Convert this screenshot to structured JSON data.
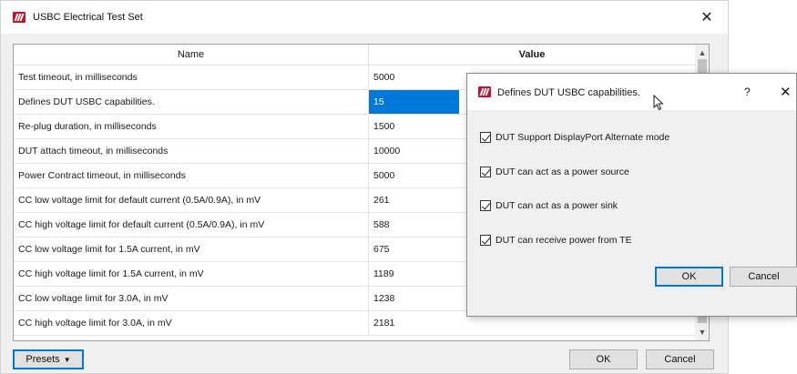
{
  "window": {
    "title": "USBC Electrical Test Set",
    "close_symbol": "✕"
  },
  "grid": {
    "headers": {
      "name": "Name",
      "value": "Value"
    },
    "rows": [
      {
        "name": "Test timeout, in milliseconds",
        "value": "5000"
      },
      {
        "name": "Defines DUT USBC capabilities.",
        "value": "15"
      },
      {
        "name": "Re-plug duration, in milliseconds",
        "value": "1500"
      },
      {
        "name": "DUT attach timeout, in milliseconds",
        "value": "10000"
      },
      {
        "name": "Power Contract timeout, in milliseconds",
        "value": "5000"
      },
      {
        "name": "CC low voltage limit for default current (0.5A/0.9A), in mV",
        "value": "261"
      },
      {
        "name": "CC high voltage limit for default current (0.5A/0.9A), in mV",
        "value": "588"
      },
      {
        "name": "CC low voltage limit for 1.5A current, in mV",
        "value": "675"
      },
      {
        "name": "CC high voltage limit for 1.5A current, in mV",
        "value": "1189"
      },
      {
        "name": "CC low voltage limit for 3.0A, in mV",
        "value": "1238"
      },
      {
        "name": "CC high voltage limit for 3.0A, in mV",
        "value": "2181"
      }
    ],
    "selected_row": 1
  },
  "buttons": {
    "presets": "Presets",
    "ok": "OK",
    "cancel": "Cancel"
  },
  "dialog": {
    "title": "Defines DUT USBC capabilities.",
    "help_symbol": "?",
    "close_symbol": "✕",
    "options": [
      {
        "label": "DUT Support DisplayPort Alternate mode",
        "checked": true
      },
      {
        "label": "DUT can act as a power source",
        "checked": true
      },
      {
        "label": "DUT can act as a power sink",
        "checked": true
      },
      {
        "label": "DUT can receive power from TE",
        "checked": true
      }
    ],
    "ok": "OK",
    "cancel": "Cancel"
  },
  "colors": {
    "accent": "#0078d7",
    "brand": "#c8102e"
  },
  "icons": {
    "app": "app-logo-icon",
    "dropdown": "chevron-down-icon",
    "scroll_up": "chevron-up-icon",
    "scroll_down": "chevron-down-icon"
  }
}
